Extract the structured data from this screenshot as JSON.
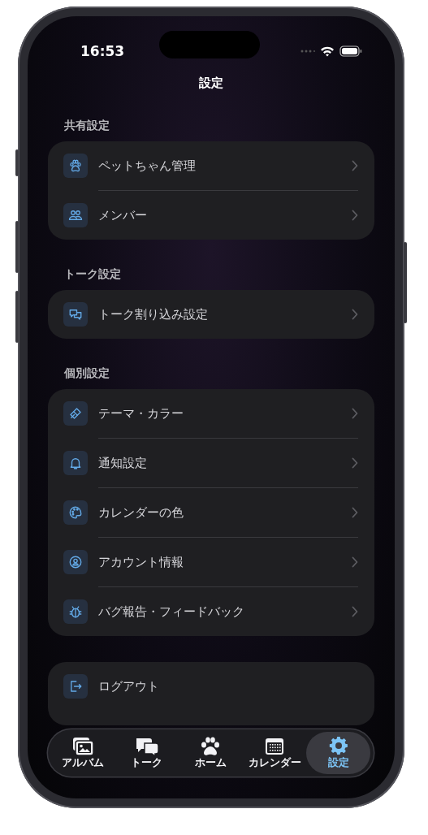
{
  "status_bar": {
    "time": "16:53"
  },
  "title": "設定",
  "sections": [
    {
      "header": "共有設定",
      "items": [
        {
          "label": "ペットちゃん管理",
          "kind": "normal"
        },
        {
          "label": "メンバー",
          "kind": "normal"
        }
      ]
    },
    {
      "header": "トーク設定",
      "items": [
        {
          "label": "トーク割り込み設定",
          "kind": "normal"
        }
      ]
    },
    {
      "header": "個別設定",
      "items": [
        {
          "label": "テーマ・カラー",
          "kind": "normal"
        },
        {
          "label": "通知設定",
          "kind": "normal"
        },
        {
          "label": "カレンダーの色",
          "kind": "normal"
        },
        {
          "label": "アカウント情報",
          "kind": "normal"
        },
        {
          "label": "バグ報告・フィードバック",
          "kind": "normal"
        }
      ]
    },
    {
      "items": [
        {
          "label": "ログアウト",
          "kind": "action"
        }
      ]
    }
  ],
  "tab_bar": [
    {
      "label": "アルバム",
      "selected": false
    },
    {
      "label": "トーク",
      "selected": false
    },
    {
      "label": "ホーム",
      "selected": false
    },
    {
      "label": "カレンダー",
      "selected": false
    },
    {
      "label": "設定",
      "selected": true
    }
  ]
}
